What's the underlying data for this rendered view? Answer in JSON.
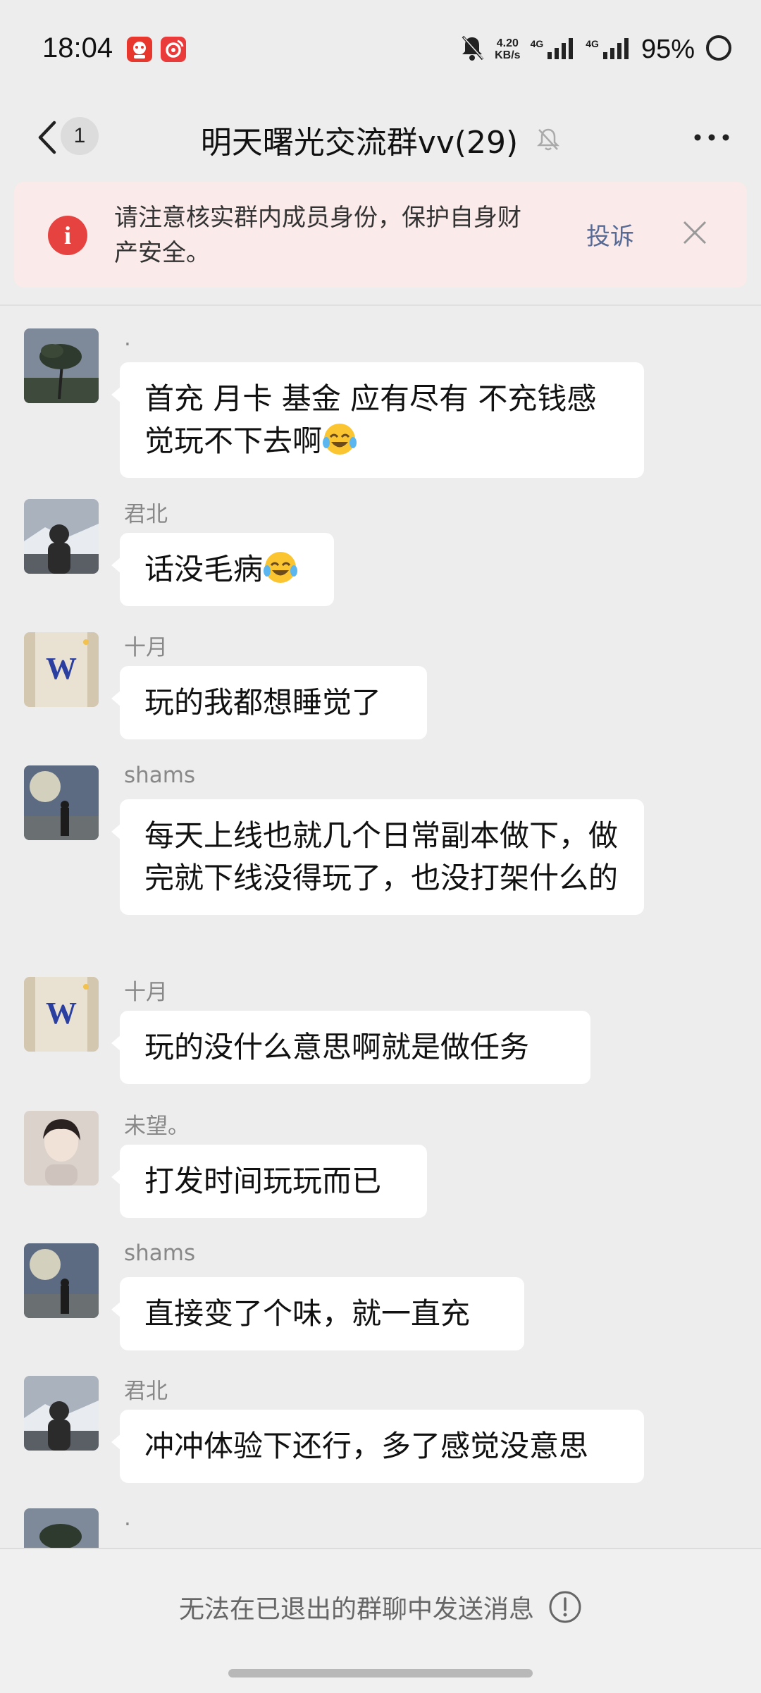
{
  "status_bar": {
    "time": "18:04",
    "speed_value": "4.20",
    "speed_unit": "KB/s",
    "network_1": "4G",
    "network_2": "4G",
    "battery": "95%"
  },
  "header": {
    "unread_count": "1",
    "title": "明天曙光交流群vv(29)"
  },
  "banner": {
    "text": "请注意核实群内成员身份，保护自身财产安全。",
    "report_label": "投诉"
  },
  "messages": [
    {
      "sender": ".",
      "text": "首充 月卡 基金 应有尽有 不充钱感觉玩不下去啊",
      "emoji": "laughing-crying-emoji"
    },
    {
      "sender": "君北",
      "text": "话没毛病",
      "emoji": "laughing-crying-emoji"
    },
    {
      "sender": "十月",
      "text": "玩的我都想睡觉了"
    },
    {
      "sender": "shams",
      "text": "每天上线也就几个日常副本做下，做完就下线没得玩了，也没打架什么的"
    },
    {
      "sender": "十月",
      "text": "玩的没什么意思啊就是做任务"
    },
    {
      "sender": "未望。",
      "text": "打发时间玩玩而已"
    },
    {
      "sender": "shams",
      "text": "直接变了个味，就一直充"
    },
    {
      "sender": "君北",
      "text": "冲冲体验下还行，多了感觉没意思"
    },
    {
      "sender": "."
    }
  ],
  "footer": {
    "text": "无法在已退出的群聊中发送消息"
  },
  "colors": {
    "background": "#ededed",
    "bubble": "#ffffff",
    "warning_red": "#e64340",
    "link_blue": "#576b95",
    "banner_bg": "#fbeaea"
  }
}
